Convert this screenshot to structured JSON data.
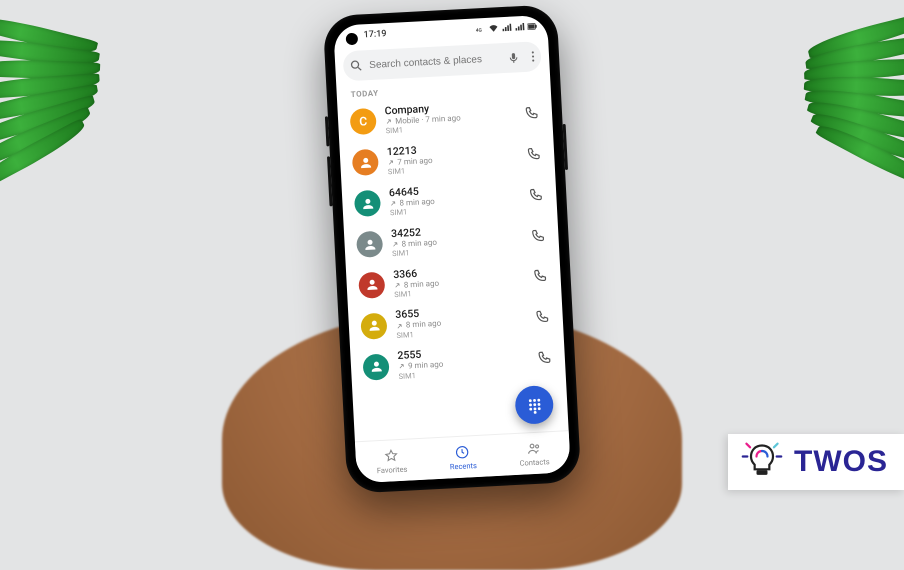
{
  "status": {
    "time": "17:19",
    "alarm": true
  },
  "search": {
    "placeholder": "Search contacts & places"
  },
  "section": "TODAY",
  "calls": [
    {
      "name": "Company",
      "avatarColor": "#f39c12",
      "avatarType": "letter",
      "avatarLetter": "C",
      "direction": "out",
      "metaPrefix": "Mobile",
      "time": "7 min ago",
      "sim": "SIM1"
    },
    {
      "name": "12213",
      "avatarColor": "#e67e22",
      "avatarType": "person",
      "direction": "out",
      "metaPrefix": "",
      "time": "7 min ago",
      "sim": "SIM1"
    },
    {
      "name": "64645",
      "avatarColor": "#148f77",
      "avatarType": "person",
      "direction": "out",
      "metaPrefix": "",
      "time": "8 min ago",
      "sim": "SIM1"
    },
    {
      "name": "34252",
      "avatarColor": "#7b8a8b",
      "avatarType": "person",
      "direction": "out",
      "metaPrefix": "",
      "time": "8 min ago",
      "sim": "SIM1"
    },
    {
      "name": "3366",
      "avatarColor": "#c0392b",
      "avatarType": "person",
      "direction": "out",
      "metaPrefix": "",
      "time": "8 min ago",
      "sim": "SIM1"
    },
    {
      "name": "3655",
      "avatarColor": "#d4ac0d",
      "avatarType": "person",
      "direction": "out",
      "metaPrefix": "",
      "time": "8 min ago",
      "sim": "SIM1"
    },
    {
      "name": "2555",
      "avatarColor": "#148f77",
      "avatarType": "person",
      "direction": "out",
      "metaPrefix": "",
      "time": "9 min ago",
      "sim": "SIM1"
    }
  ],
  "nav": {
    "favorites": "Favorites",
    "recents": "Recents",
    "contacts": "Contacts"
  },
  "fab_name": "dialpad",
  "watermark": {
    "text": "TWOS"
  }
}
